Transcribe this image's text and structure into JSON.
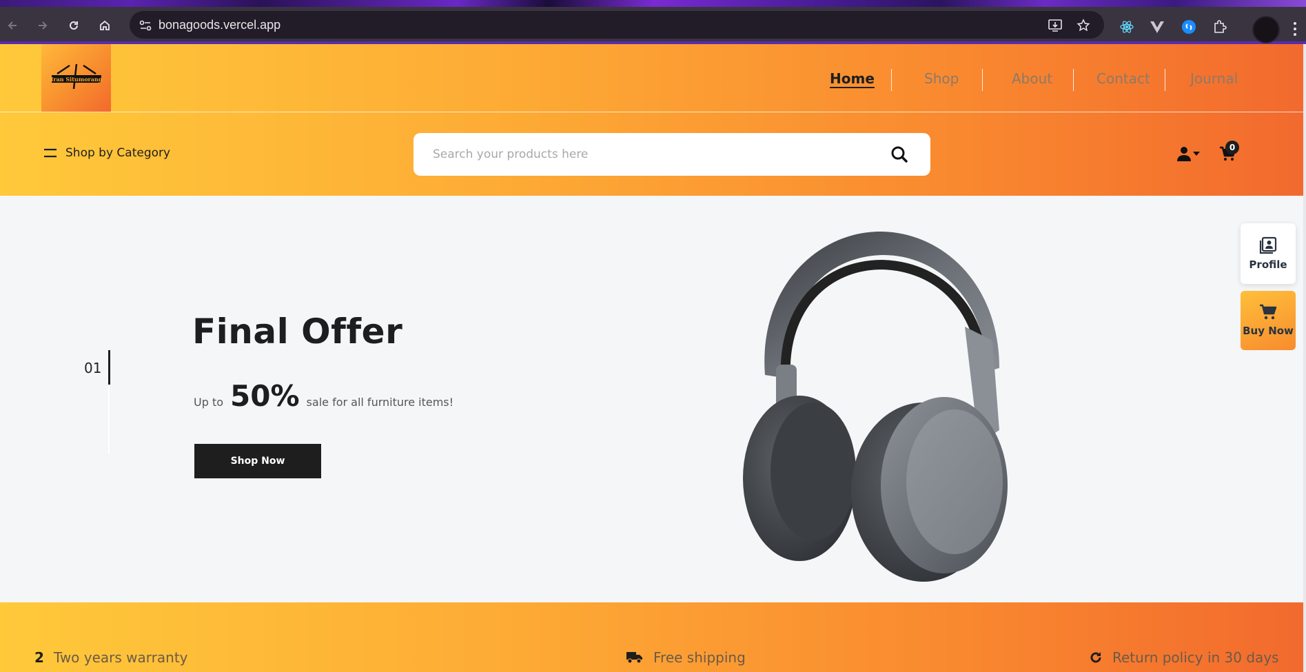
{
  "browser": {
    "url": "bonagoods.vercel.app",
    "icons": [
      "back-icon",
      "forward-icon",
      "reload-icon",
      "home-icon",
      "site-info-icon",
      "install-app-icon",
      "bookmark-star-icon",
      "react-devtools-icon",
      "vue-devtools-icon",
      "shazam-icon",
      "extensions-icon",
      "profile-avatar",
      "menu-icon"
    ]
  },
  "header": {
    "logo_text": "Iran Situmorang",
    "nav": [
      "Home",
      "Shop",
      "About",
      "Contact",
      "Journal"
    ],
    "active_nav": "Home",
    "category_label": "Shop by Category",
    "search_placeholder": "Search your products here",
    "cart_count": "0"
  },
  "hero": {
    "slide_number": "01",
    "title": "Final Offer",
    "sub_prefix": "Up to",
    "sub_percent": "50%",
    "sub_suffix": "sale for all furniture items!",
    "cta": "Shop Now"
  },
  "side_actions": {
    "profile": "Profile",
    "buy": "Buy Now"
  },
  "features": {
    "warranty_num": "2",
    "warranty": "Two years warranty",
    "shipping": "Free shipping",
    "returns": "Return policy in 30 days"
  },
  "colors": {
    "header_gradient_start": "#ffc93a",
    "header_gradient_end": "#f26a2e",
    "dark": "#1e1e1e",
    "hero_bg": "#f4f6f8"
  }
}
